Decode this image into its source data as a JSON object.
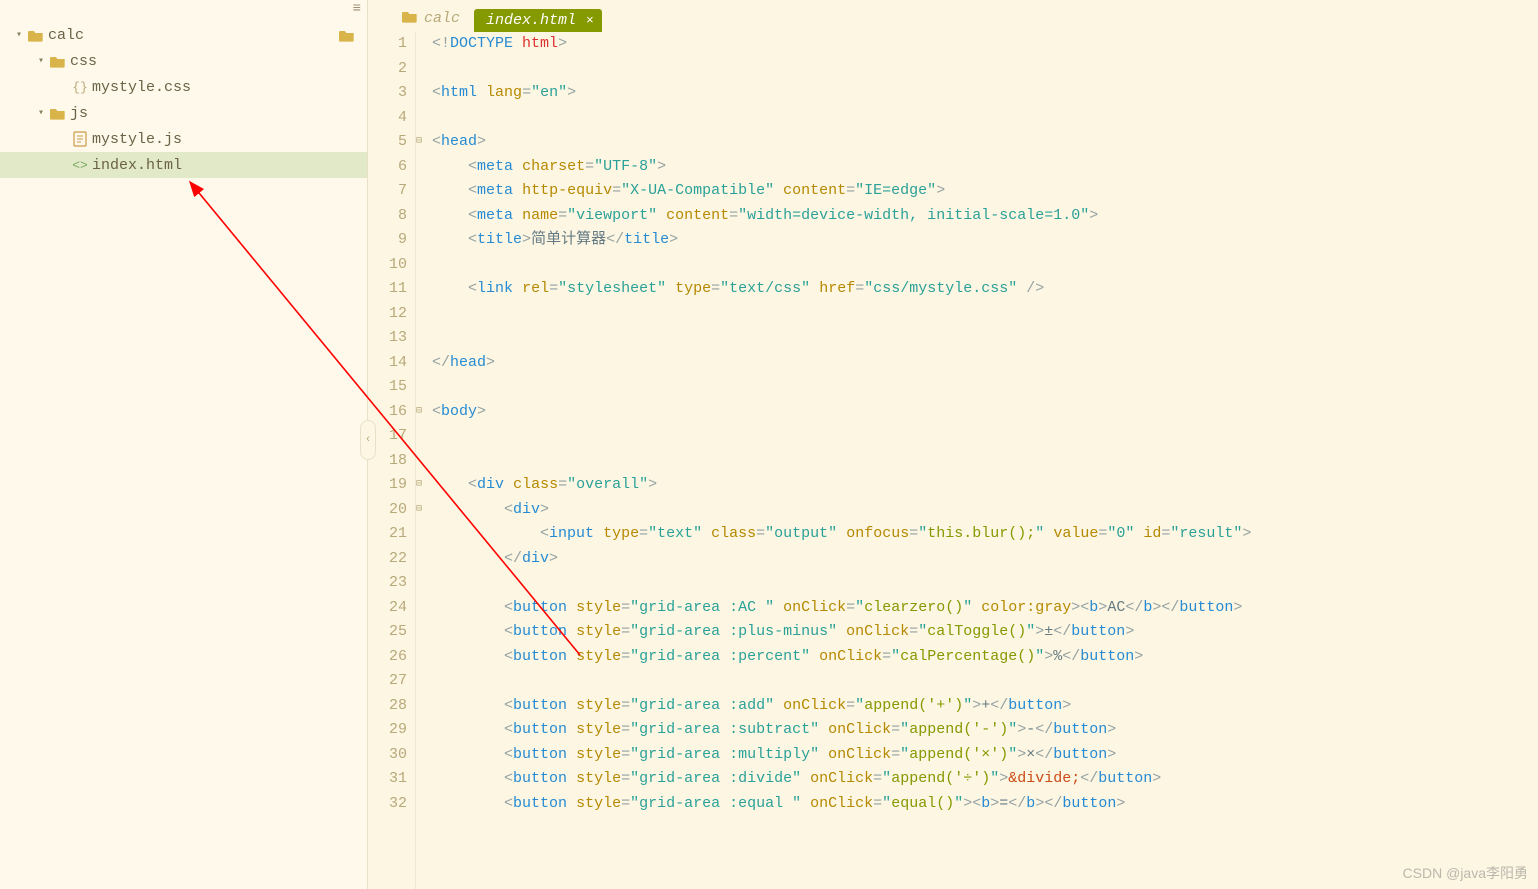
{
  "sidebar": {
    "root": {
      "name": "calc",
      "expanded": true
    },
    "items": [
      {
        "name": "css",
        "type": "folder",
        "expanded": true,
        "depth": 1
      },
      {
        "name": "mystyle.css",
        "type": "css",
        "depth": 2
      },
      {
        "name": "js",
        "type": "folder",
        "expanded": true,
        "depth": 1
      },
      {
        "name": "mystyle.js",
        "type": "js",
        "depth": 2
      },
      {
        "name": "index.html",
        "type": "html",
        "depth": 2,
        "selected": true
      }
    ]
  },
  "breadcrumb": {
    "folder": "calc"
  },
  "tab": {
    "label": "index.html"
  },
  "code": {
    "lines": [
      {
        "n": 1,
        "fold": "",
        "html": "<span class='punct'>&lt;!</span><span class='tag'>DOCTYPE</span> <span class='doctype-kw'>html</span><span class='punct'>&gt;</span>"
      },
      {
        "n": 2,
        "fold": "",
        "html": ""
      },
      {
        "n": 3,
        "fold": "",
        "html": "<span class='punct'>&lt;</span><span class='tag'>html</span> <span class='attr'>lang</span><span class='punct'>=</span><span class='str'>\"en\"</span><span class='punct'>&gt;</span>"
      },
      {
        "n": 4,
        "fold": "",
        "html": ""
      },
      {
        "n": 5,
        "fold": "⊟",
        "html": "<span class='punct'>&lt;</span><span class='tag'>head</span><span class='punct'>&gt;</span>"
      },
      {
        "n": 6,
        "fold": "",
        "html": "    <span class='punct'>&lt;</span><span class='tag'>meta</span> <span class='attr'>charset</span><span class='punct'>=</span><span class='str'>\"UTF-8\"</span><span class='punct'>&gt;</span>"
      },
      {
        "n": 7,
        "fold": "",
        "html": "    <span class='punct'>&lt;</span><span class='tag'>meta</span> <span class='attr'>http-equiv</span><span class='punct'>=</span><span class='str'>\"X-UA-Compatible\"</span> <span class='attr'>content</span><span class='punct'>=</span><span class='str'>\"IE=edge\"</span><span class='punct'>&gt;</span>"
      },
      {
        "n": 8,
        "fold": "",
        "html": "    <span class='punct'>&lt;</span><span class='tag'>meta</span> <span class='attr'>name</span><span class='punct'>=</span><span class='str'>\"viewport\"</span> <span class='attr'>content</span><span class='punct'>=</span><span class='str'>\"width=device-width, initial-scale=1.0\"</span><span class='punct'>&gt;</span>"
      },
      {
        "n": 9,
        "fold": "",
        "html": "    <span class='punct'>&lt;</span><span class='tag'>title</span><span class='punct'>&gt;</span><span class='txt'>简单计算器</span><span class='punct'>&lt;/</span><span class='tag'>title</span><span class='punct'>&gt;</span>"
      },
      {
        "n": 10,
        "fold": "",
        "html": ""
      },
      {
        "n": 11,
        "fold": "",
        "html": "    <span class='punct'>&lt;</span><span class='tag'>link</span> <span class='attr'>rel</span><span class='punct'>=</span><span class='str'>\"stylesheet\"</span> <span class='attr'>type</span><span class='punct'>=</span><span class='str'>\"text/css\"</span> <span class='attr'>href</span><span class='punct'>=</span><span class='str'>\"css/mystyle.css\"</span> <span class='punct'>/&gt;</span>"
      },
      {
        "n": 12,
        "fold": "",
        "html": ""
      },
      {
        "n": 13,
        "fold": "",
        "html": ""
      },
      {
        "n": 14,
        "fold": "",
        "html": "<span class='punct'>&lt;/</span><span class='tag'>head</span><span class='punct'>&gt;</span>"
      },
      {
        "n": 15,
        "fold": "",
        "html": ""
      },
      {
        "n": 16,
        "fold": "⊟",
        "html": "<span class='punct'>&lt;</span><span class='tag'>body</span><span class='punct'>&gt;</span>"
      },
      {
        "n": 17,
        "fold": "",
        "html": ""
      },
      {
        "n": 18,
        "fold": "",
        "html": ""
      },
      {
        "n": 19,
        "fold": "⊟",
        "html": "    <span class='punct'>&lt;</span><span class='tag'>div</span> <span class='attr'>class</span><span class='punct'>=</span><span class='str'>\"overall\"</span><span class='punct'>&gt;</span>"
      },
      {
        "n": 20,
        "fold": "⊟",
        "html": "        <span class='punct'>&lt;</span><span class='tag'>div</span><span class='punct'>&gt;</span>"
      },
      {
        "n": 21,
        "fold": "",
        "html": "            <span class='punct'>&lt;</span><span class='tag'>input</span> <span class='attr'>type</span><span class='punct'>=</span><span class='str'>\"text\"</span> <span class='attr'>class</span><span class='punct'>=</span><span class='str'>\"output\"</span> <span class='attr'>onfocus</span><span class='punct'>=</span><span class='str'>\"</span><span class='fn'>this.blur();</span><span class='str'>\"</span> <span class='attr'>value</span><span class='punct'>=</span><span class='str'>\"0\"</span> <span class='attr'>id</span><span class='punct'>=</span><span class='str'>\"result\"</span><span class='punct'>&gt;</span>"
      },
      {
        "n": 22,
        "fold": "",
        "html": "        <span class='punct'>&lt;/</span><span class='tag'>div</span><span class='punct'>&gt;</span>"
      },
      {
        "n": 23,
        "fold": "",
        "html": ""
      },
      {
        "n": 24,
        "fold": "",
        "html": "        <span class='punct'>&lt;</span><span class='tag'>button</span> <span class='attr'>style</span><span class='punct'>=</span><span class='str'>\"grid-area :AC \"</span> <span class='attr'>onClick</span><span class='punct'>=</span><span class='str'>\"</span><span class='fn'>clearzero()</span><span class='str'>\"</span> <span class='attr'>color:gray</span><span class='punct'>&gt;&lt;</span><span class='tag'>b</span><span class='punct'>&gt;</span><span class='txt'>AC</span><span class='punct'>&lt;/</span><span class='tag'>b</span><span class='punct'>&gt;&lt;/</span><span class='tag'>button</span><span class='punct'>&gt;</span>"
      },
      {
        "n": 25,
        "fold": "",
        "html": "        <span class='punct'>&lt;</span><span class='tag'>button</span> <span class='attr'>style</span><span class='punct'>=</span><span class='str'>\"grid-area :plus-minus\"</span> <span class='attr'>onClick</span><span class='punct'>=</span><span class='str'>\"</span><span class='fn'>calToggle()</span><span class='str'>\"</span><span class='punct'>&gt;</span><span class='txt'>±</span><span class='punct'>&lt;/</span><span class='tag'>button</span><span class='punct'>&gt;</span>"
      },
      {
        "n": 26,
        "fold": "",
        "html": "        <span class='punct'>&lt;</span><span class='tag'>button</span> <span class='attr'>style</span><span class='punct'>=</span><span class='str'>\"grid-area :percent\"</span> <span class='attr'>onClick</span><span class='punct'>=</span><span class='str'>\"</span><span class='fn'>calPercentage()</span><span class='str'>\"</span><span class='punct'>&gt;</span><span class='txt'>%</span><span class='punct'>&lt;/</span><span class='tag'>button</span><span class='punct'>&gt;</span>"
      },
      {
        "n": 27,
        "fold": "",
        "html": ""
      },
      {
        "n": 28,
        "fold": "",
        "html": "        <span class='punct'>&lt;</span><span class='tag'>button</span> <span class='attr'>style</span><span class='punct'>=</span><span class='str'>\"grid-area :add\"</span> <span class='attr'>onClick</span><span class='punct'>=</span><span class='str'>\"</span><span class='fn'>append('+')</span><span class='str'>\"</span><span class='punct'>&gt;</span><span class='txt'>+</span><span class='punct'>&lt;/</span><span class='tag'>button</span><span class='punct'>&gt;</span>"
      },
      {
        "n": 29,
        "fold": "",
        "html": "        <span class='punct'>&lt;</span><span class='tag'>button</span> <span class='attr'>style</span><span class='punct'>=</span><span class='str'>\"grid-area :subtract\"</span> <span class='attr'>onClick</span><span class='punct'>=</span><span class='str'>\"</span><span class='fn'>append('-')</span><span class='str'>\"</span><span class='punct'>&gt;</span><span class='txt'>-</span><span class='punct'>&lt;/</span><span class='tag'>button</span><span class='punct'>&gt;</span>"
      },
      {
        "n": 30,
        "fold": "",
        "html": "        <span class='punct'>&lt;</span><span class='tag'>button</span> <span class='attr'>style</span><span class='punct'>=</span><span class='str'>\"grid-area :multiply\"</span> <span class='attr'>onClick</span><span class='punct'>=</span><span class='str'>\"</span><span class='fn'>append('×')</span><span class='str'>\"</span><span class='punct'>&gt;</span><span class='txt'>×</span><span class='punct'>&lt;/</span><span class='tag'>button</span><span class='punct'>&gt;</span>"
      },
      {
        "n": 31,
        "fold": "",
        "html": "        <span class='punct'>&lt;</span><span class='tag'>button</span> <span class='attr'>style</span><span class='punct'>=</span><span class='str'>\"grid-area :divide\"</span> <span class='attr'>onClick</span><span class='punct'>=</span><span class='str'>\"</span><span class='fn'>append('÷')</span><span class='str'>\"</span><span class='punct'>&gt;</span><span class='entity'>&amp;divide;</span><span class='punct'>&lt;/</span><span class='tag'>button</span><span class='punct'>&gt;</span>"
      },
      {
        "n": 32,
        "fold": "",
        "html": "        <span class='punct'>&lt;</span><span class='tag'>button</span> <span class='attr'>style</span><span class='punct'>=</span><span class='str'>\"grid-area :equal \"</span> <span class='attr'>onClick</span><span class='punct'>=</span><span class='str'>\"</span><span class='fn'>equal()</span><span class='str'>\"</span><span class='punct'>&gt;&lt;</span><span class='tag'>b</span><span class='punct'>&gt;</span><span class='txt'>=</span><span class='punct'>&lt;/</span><span class='tag'>b</span><span class='punct'>&gt;&lt;/</span><span class='tag'>button</span><span class='punct'>&gt;</span>"
      }
    ]
  },
  "watermark": "CSDN @java李阳勇"
}
